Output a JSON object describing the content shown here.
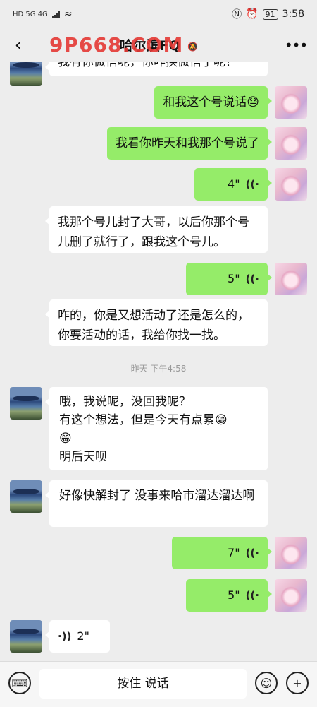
{
  "status": {
    "left_icons": "HD 5G 4G",
    "battery": "91",
    "time": "3:58"
  },
  "header": {
    "title": "哈尔滨FQ",
    "watermark": "9P668.COM"
  },
  "messages": [
    {
      "side": "other",
      "text": "我有你微信呢，你咋换微信了呢？"
    },
    {
      "side": "me",
      "text": "和我这个号说话😓"
    },
    {
      "side": "me",
      "text": "我看你昨天和我那个号说了"
    },
    {
      "side": "me",
      "voice": "4\""
    },
    {
      "side": "other",
      "text": "我那个号儿封了大哥，以后你那个号儿删了就行了，跟我这个号儿。"
    },
    {
      "side": "me",
      "voice": "5\""
    },
    {
      "side": "other",
      "text": "咋的，你是又想活动了还是怎么的，你要活动的话，我给你找一找。"
    },
    {
      "timestamp": "昨天 下午4:58"
    },
    {
      "side": "other",
      "lines": [
        "哦，我说呢，没回我呢？",
        "有这个想法，但是今天有点累😁",
        "😁",
        "明后天呗"
      ]
    },
    {
      "side": "other",
      "text": "好像快解封了   没事来哈市溜达溜达啊"
    },
    {
      "side": "me",
      "voice": "7\""
    },
    {
      "side": "me",
      "voice": "5\""
    },
    {
      "side": "other",
      "voice": "2\""
    }
  ],
  "input": {
    "hold_to_talk": "按住 说话"
  }
}
